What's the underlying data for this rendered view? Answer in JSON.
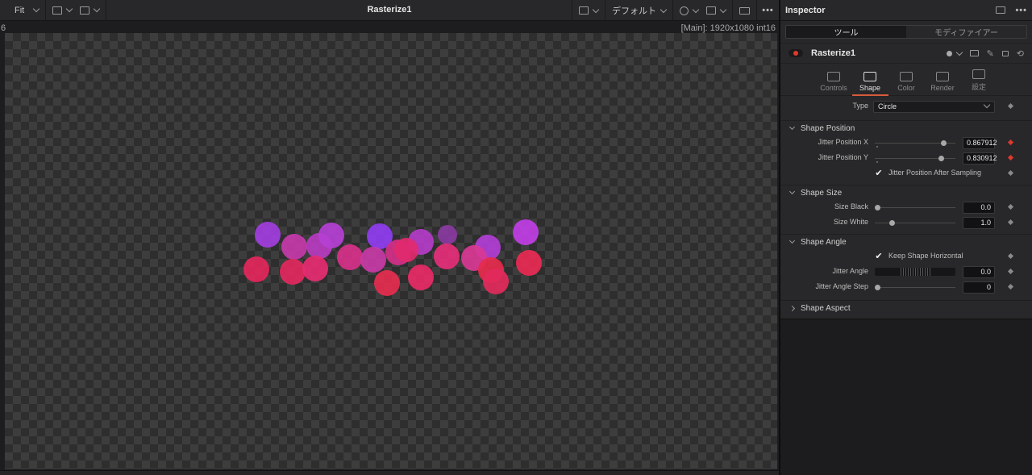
{
  "viewer": {
    "zoom_label": "Fit",
    "title": "Rasterize1",
    "lut_label": "デフォルト",
    "status": "[Main]: 1920x1080 int16",
    "left_number": "6",
    "more_label": "•••"
  },
  "circles": [
    {
      "color": "#a23ee0"
    },
    {
      "color": "#c63aaa"
    },
    {
      "color": "#b93cc0"
    },
    {
      "color": "#b540d4"
    },
    {
      "color": "#8f3df0"
    },
    {
      "color": "#b43cc8"
    },
    {
      "color": "#8a3aa0"
    },
    {
      "color": "#c13ee6"
    },
    {
      "color": "#b23ed6"
    },
    {
      "color": "#d42f8a"
    },
    {
      "color": "#e3265b"
    },
    {
      "color": "#e4285e"
    },
    {
      "color": "#e62b72"
    },
    {
      "color": "#d8318a"
    },
    {
      "color": "#c83aa6"
    },
    {
      "color": "#e62f7a"
    },
    {
      "color": "#d93894"
    },
    {
      "color": "#e72a4c"
    },
    {
      "color": "#e22a5c"
    },
    {
      "color": "#ea2a52"
    },
    {
      "color": "#e72c4f"
    },
    {
      "color": "#e82a66"
    },
    {
      "color": "#e22a6e"
    }
  ],
  "inspector": {
    "title": "Inspector",
    "more_label": "•••",
    "segments": [
      "ツール",
      "モディファイアー"
    ],
    "node_name": "Rasterize1",
    "tabs": [
      {
        "label": "Controls",
        "icon": "controls-icon"
      },
      {
        "label": "Shape",
        "icon": "shape-icon"
      },
      {
        "label": "Color",
        "icon": "color-icon"
      },
      {
        "label": "Render",
        "icon": "render-icon"
      },
      {
        "label": "設定",
        "icon": "settings-icon"
      }
    ],
    "type_label": "Type",
    "type_value": "Circle",
    "shape_position": {
      "title": "Shape Position",
      "jitter_x_label": "Jitter Position X",
      "jitter_x_value": "0.867912",
      "jitter_y_label": "Jitter Position Y",
      "jitter_y_value": "0.830912",
      "after_sampling_label": "Jitter Position After Sampling",
      "after_sampling_checked": true
    },
    "shape_size": {
      "title": "Shape Size",
      "size_black_label": "Size Black",
      "size_black_value": "0.0",
      "size_white_label": "Size White",
      "size_white_value": "1.0"
    },
    "shape_angle": {
      "title": "Shape Angle",
      "keep_horizontal_label": "Keep Shape Horizontal",
      "keep_horizontal_checked": true,
      "jitter_angle_label": "Jitter Angle",
      "jitter_angle_value": "0.0",
      "jitter_step_label": "Jitter Angle Step",
      "jitter_step_value": "0"
    },
    "shape_aspect": {
      "title": "Shape Aspect"
    },
    "colors": {
      "keyframe_active": "#e0392e",
      "tab_accent": "#d65a3a"
    }
  }
}
